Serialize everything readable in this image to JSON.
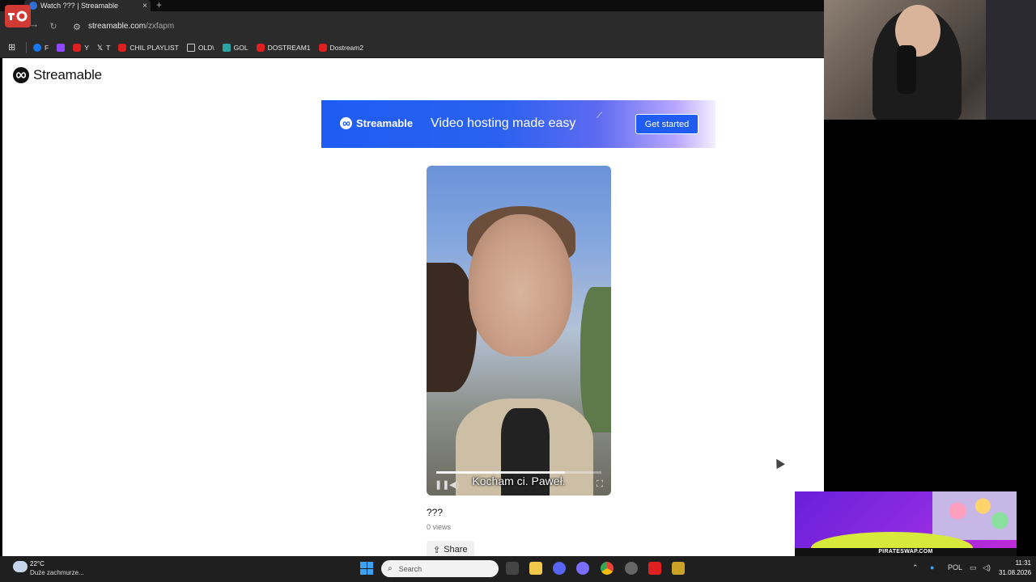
{
  "browser": {
    "tab_title": "Watch ??? | Streamable",
    "tab_close": "×",
    "new_tab": "+",
    "url_host": "streamable.com",
    "url_path": "/zxfapm",
    "bookmarks": [
      "F",
      "Y",
      "T",
      "CHIL PLAYLIST",
      "OLD\\",
      "GOL",
      "DOSTREAM1",
      "Dostream2"
    ]
  },
  "page": {
    "logo_text": "Streamable",
    "ad": {
      "logo_text": "Streamable",
      "tagline": "Video hosting made easy",
      "cta": "Get started"
    },
    "video": {
      "caption": "Kocham ci. Paweł.",
      "progress": 0.78,
      "title": "???",
      "views": "0 views"
    },
    "share_label": "Share"
  },
  "overlay": {
    "sponsor_text": "PIRATESWAP.COM"
  },
  "taskbar": {
    "weather_temp": "22°C",
    "weather_desc": "Duże zachmurze...",
    "search_placeholder": "Search",
    "language": "POL",
    "time": "11:31",
    "date": "31.08.2026"
  }
}
